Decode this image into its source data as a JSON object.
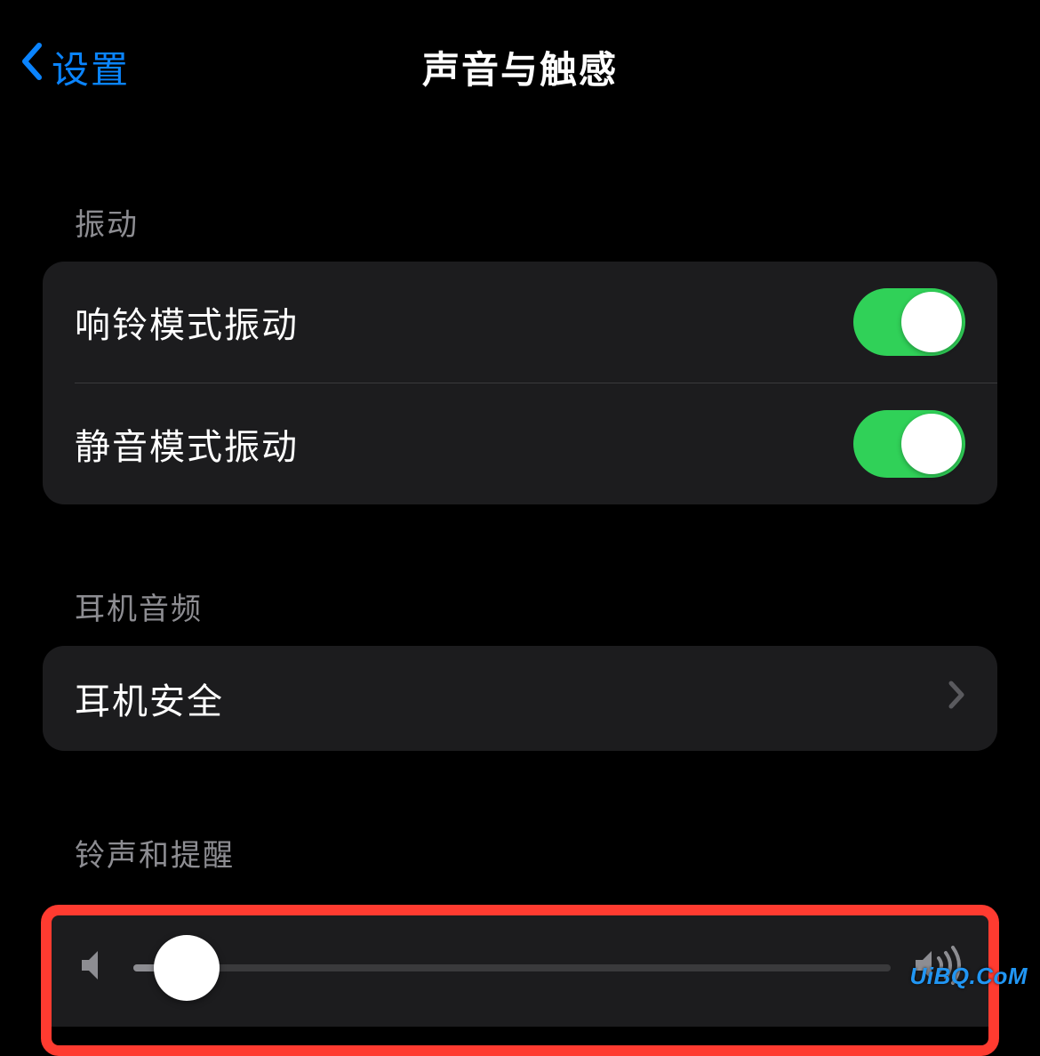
{
  "nav": {
    "back_label": "设置",
    "title": "声音与触感"
  },
  "sections": {
    "vibration": {
      "header": "振动",
      "ring_vibrate_label": "响铃模式振动",
      "ring_vibrate_on": true,
      "silent_vibrate_label": "静音模式振动",
      "silent_vibrate_on": true
    },
    "headphone": {
      "header": "耳机音频",
      "safety_label": "耳机安全"
    },
    "ringer": {
      "header": "铃声和提醒",
      "slider_value_percent": 7
    }
  },
  "watermark": "UiBQ.CoM"
}
